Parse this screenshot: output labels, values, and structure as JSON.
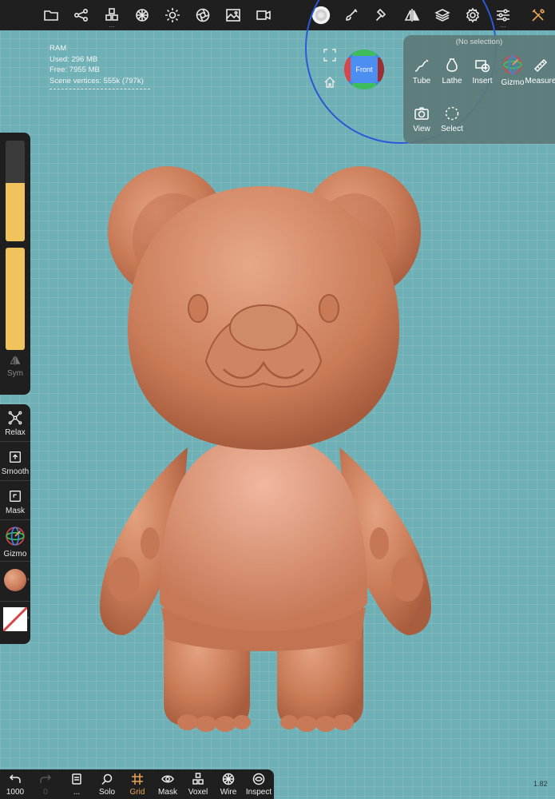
{
  "toolbar": {
    "items": [
      "folder-icon",
      "scene-graph-icon",
      "primitives-icon",
      "material-icon",
      "light-icon",
      "camera-aperture-icon",
      "background-image-icon",
      "video-icon",
      "brush-alpha-icon",
      "paint-brush-icon",
      "hammer-icon",
      "symmetry-icon",
      "layers-icon",
      "settings-icon",
      "sliders-icon",
      "tools-icon"
    ],
    "accent": "#e8a455"
  },
  "ram": {
    "title": "RAM",
    "used": "Used: 296 MB",
    "free": "Free: 7955 MB",
    "vertices": "Scene vertices: 555k (797k)"
  },
  "gizmo": {
    "face_label": "Front"
  },
  "tools_panel": {
    "title": "(No selection)",
    "items": [
      {
        "label": "Tube",
        "icon": "tube-icon"
      },
      {
        "label": "Lathe",
        "icon": "lathe-icon"
      },
      {
        "label": "Insert",
        "icon": "insert-icon"
      },
      {
        "label": "Gizmo",
        "icon": "gizmo-icon"
      },
      {
        "label": "Measure",
        "icon": "ruler-icon"
      },
      {
        "label": "View",
        "icon": "camera-icon"
      },
      {
        "label": "Select",
        "icon": "select-lasso-icon"
      }
    ]
  },
  "sidebar": {
    "radius_level": 0.58,
    "intensity_level": 1.0,
    "sym_label": "Sym",
    "tools": [
      {
        "label": "Relax",
        "icon": "relax-icon"
      },
      {
        "label": "Smooth",
        "icon": "smooth-icon"
      },
      {
        "label": "Mask",
        "icon": "mask-icon"
      },
      {
        "label": "Gizmo",
        "icon": "gizmo-icon"
      }
    ],
    "material_color": "#c87a5a",
    "accent_color": "#f0c35c"
  },
  "bottombar": {
    "undo_count": "1000",
    "redo_count": "0",
    "more_label": "...",
    "solo": "Solo",
    "grid": "Grid",
    "mask": "Mask",
    "voxel": "Voxel",
    "wire": "Wire",
    "inspect": "Inspect"
  },
  "zoom_level": "1.82",
  "colors": {
    "background": "#6fb0b6",
    "clay": "#c97b58",
    "panel": "#1f1f20"
  }
}
